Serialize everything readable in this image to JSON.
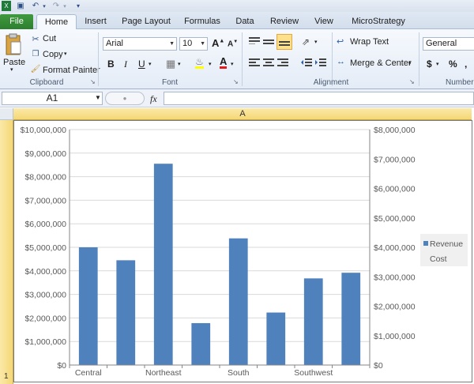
{
  "ribbon_tabs": [
    "File",
    "Home",
    "Insert",
    "Page Layout",
    "Formulas",
    "Data",
    "Review",
    "View",
    "MicroStrategy"
  ],
  "clipboard": {
    "paste": "Paste",
    "cut": "Cut",
    "copy": "Copy",
    "format_painter": "Format Painter",
    "label": "Clipboard"
  },
  "font": {
    "name": "Arial",
    "size": "10",
    "bold": "B",
    "italic": "I",
    "underline": "U",
    "label": "Font"
  },
  "alignment": {
    "wrap_text": "Wrap Text",
    "merge_center": "Merge & Center",
    "label": "Alignment"
  },
  "number": {
    "format": "General",
    "currency": "$",
    "percent": "%",
    "label": "Number"
  },
  "formula_bar": {
    "cell_ref": "A1",
    "fx": "fx",
    "value": ""
  },
  "sheet": {
    "column": "A",
    "row": "1"
  },
  "colors": {
    "bar": "#4f81bd",
    "file_tab": "#2e7f2e",
    "grid": "#d9d9d9"
  },
  "chart_data": {
    "type": "bar",
    "categories": [
      "Central",
      "",
      "Northeast",
      "",
      "South",
      "",
      "Southwest",
      ""
    ],
    "series": [
      {
        "name": "Revenue",
        "values": [
          5000000,
          4450000,
          8550000,
          1780000,
          5380000,
          2230000,
          3680000,
          3920000
        ]
      }
    ],
    "legend": [
      "Revenue",
      "Cost"
    ],
    "legend_position": "right",
    "ylim_left": [
      0,
      10000000
    ],
    "yticks_left": [
      "$0",
      "$1,000,000",
      "$2,000,000",
      "$3,000,000",
      "$4,000,000",
      "$5,000,000",
      "$6,000,000",
      "$7,000,000",
      "$8,000,000",
      "$9,000,000",
      "$10,000,000"
    ],
    "ylim_right": [
      0,
      8000000
    ],
    "yticks_right": [
      "$0",
      "$1,000,000",
      "$2,000,000",
      "$3,000,000",
      "$4,000,000",
      "$5,000,000",
      "$6,000,000",
      "$7,000,000",
      "$8,000,000"
    ],
    "grid": true
  }
}
